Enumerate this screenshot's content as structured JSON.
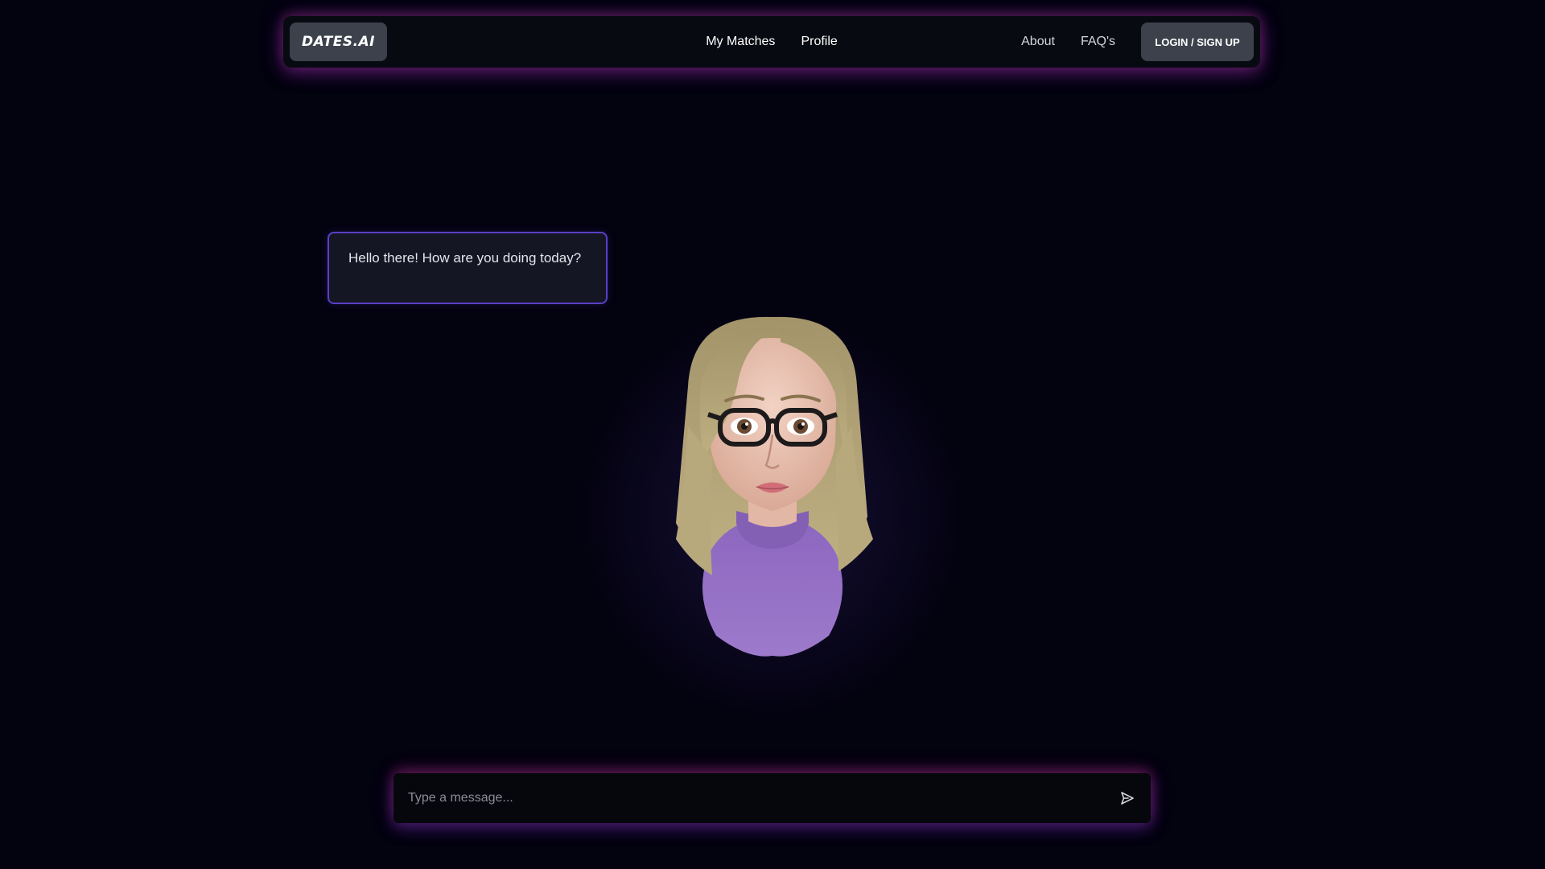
{
  "nav": {
    "logo": "DATES.AI",
    "links_center": [
      {
        "label": "My Matches"
      },
      {
        "label": "Profile"
      }
    ],
    "links_right": [
      {
        "label": "About"
      },
      {
        "label": "FAQ's"
      }
    ],
    "login_label": "LOGIN / SIGN UP"
  },
  "chat": {
    "bubble_text": "Hello there! How are you doing today?",
    "input_placeholder": "Type a message...",
    "input_value": ""
  },
  "icons": {
    "send": "send-icon"
  },
  "colors": {
    "background": "#03020f",
    "navbar": "#080a12",
    "button": "#3c414b",
    "bubble_border": "#5b3fc6",
    "sweater": "#9470c4",
    "hair": "#b3a47a"
  }
}
